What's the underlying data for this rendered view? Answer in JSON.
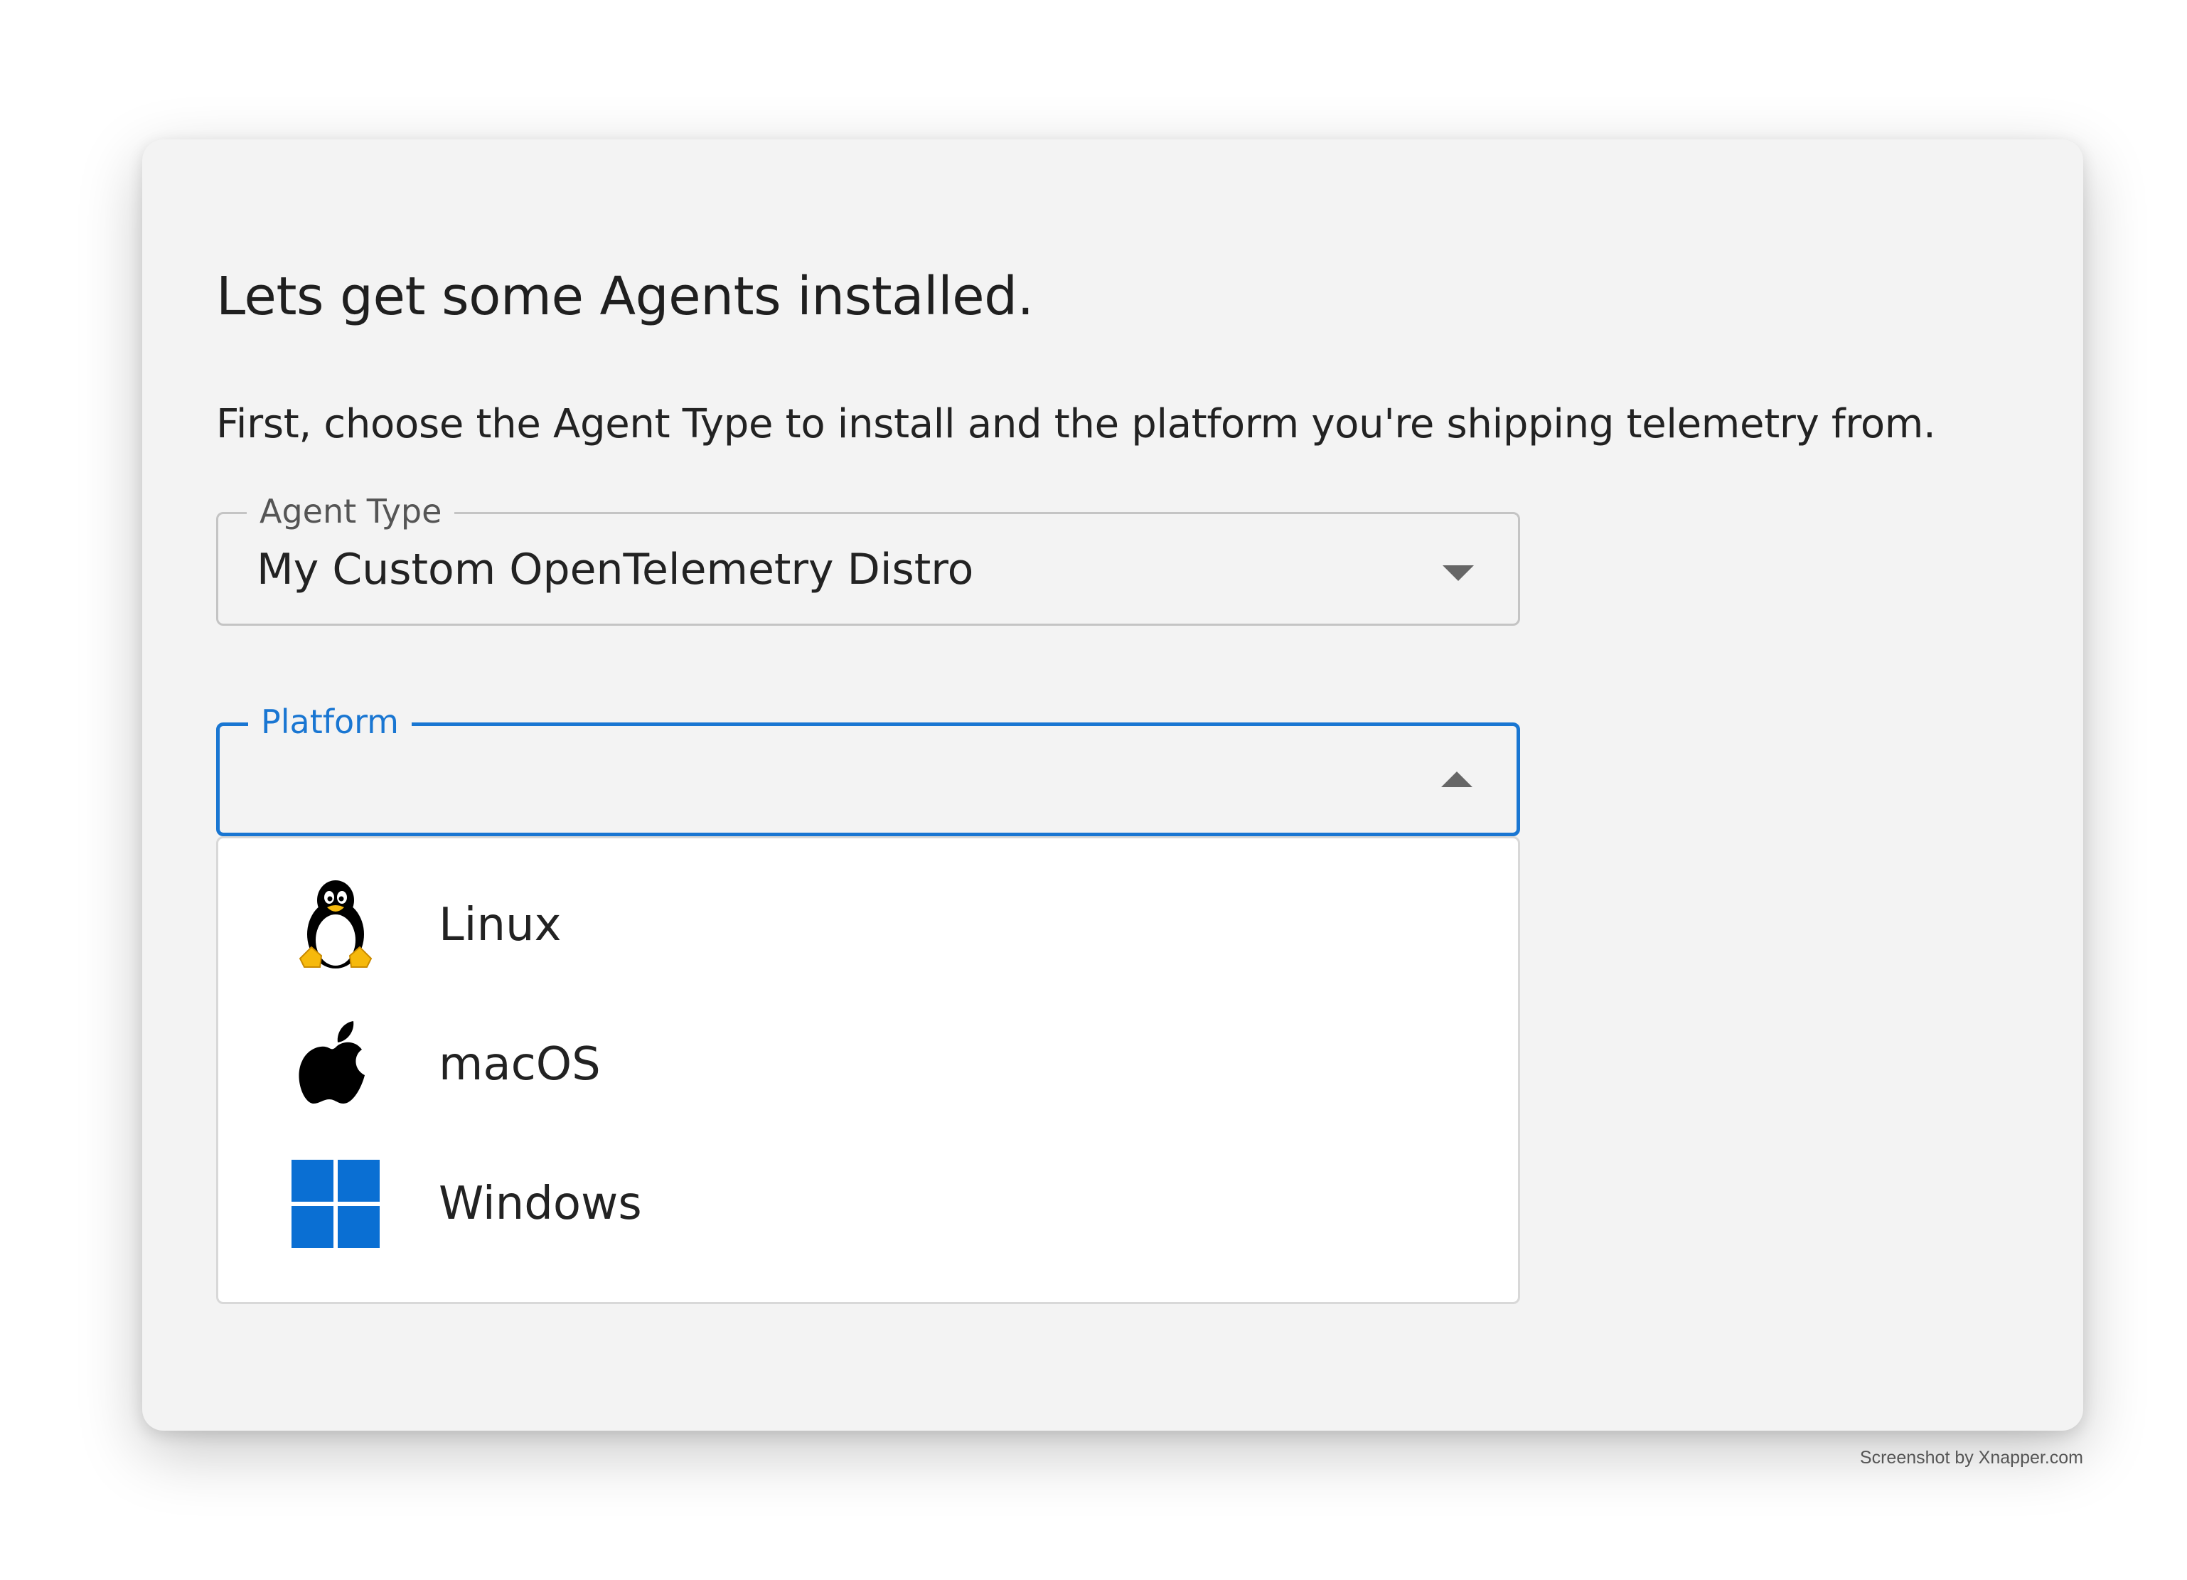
{
  "dialog": {
    "title": "Lets get some Agents installed.",
    "subtitle": "First, choose the Agent Type to install and the platform you're shipping telemetry from."
  },
  "agent_type": {
    "label": "Agent Type",
    "value": "My Custom OpenTelemetry Distro",
    "icon": "caret-down-icon"
  },
  "platform": {
    "label": "Platform",
    "value": "",
    "icon": "caret-up-icon",
    "accent_color": "#1976d2",
    "options": [
      {
        "label": "Linux",
        "icon": "linux-icon"
      },
      {
        "label": "macOS",
        "icon": "apple-icon"
      },
      {
        "label": "Windows",
        "icon": "windows-icon"
      }
    ]
  },
  "watermark": "Screenshot by Xnapper.com"
}
